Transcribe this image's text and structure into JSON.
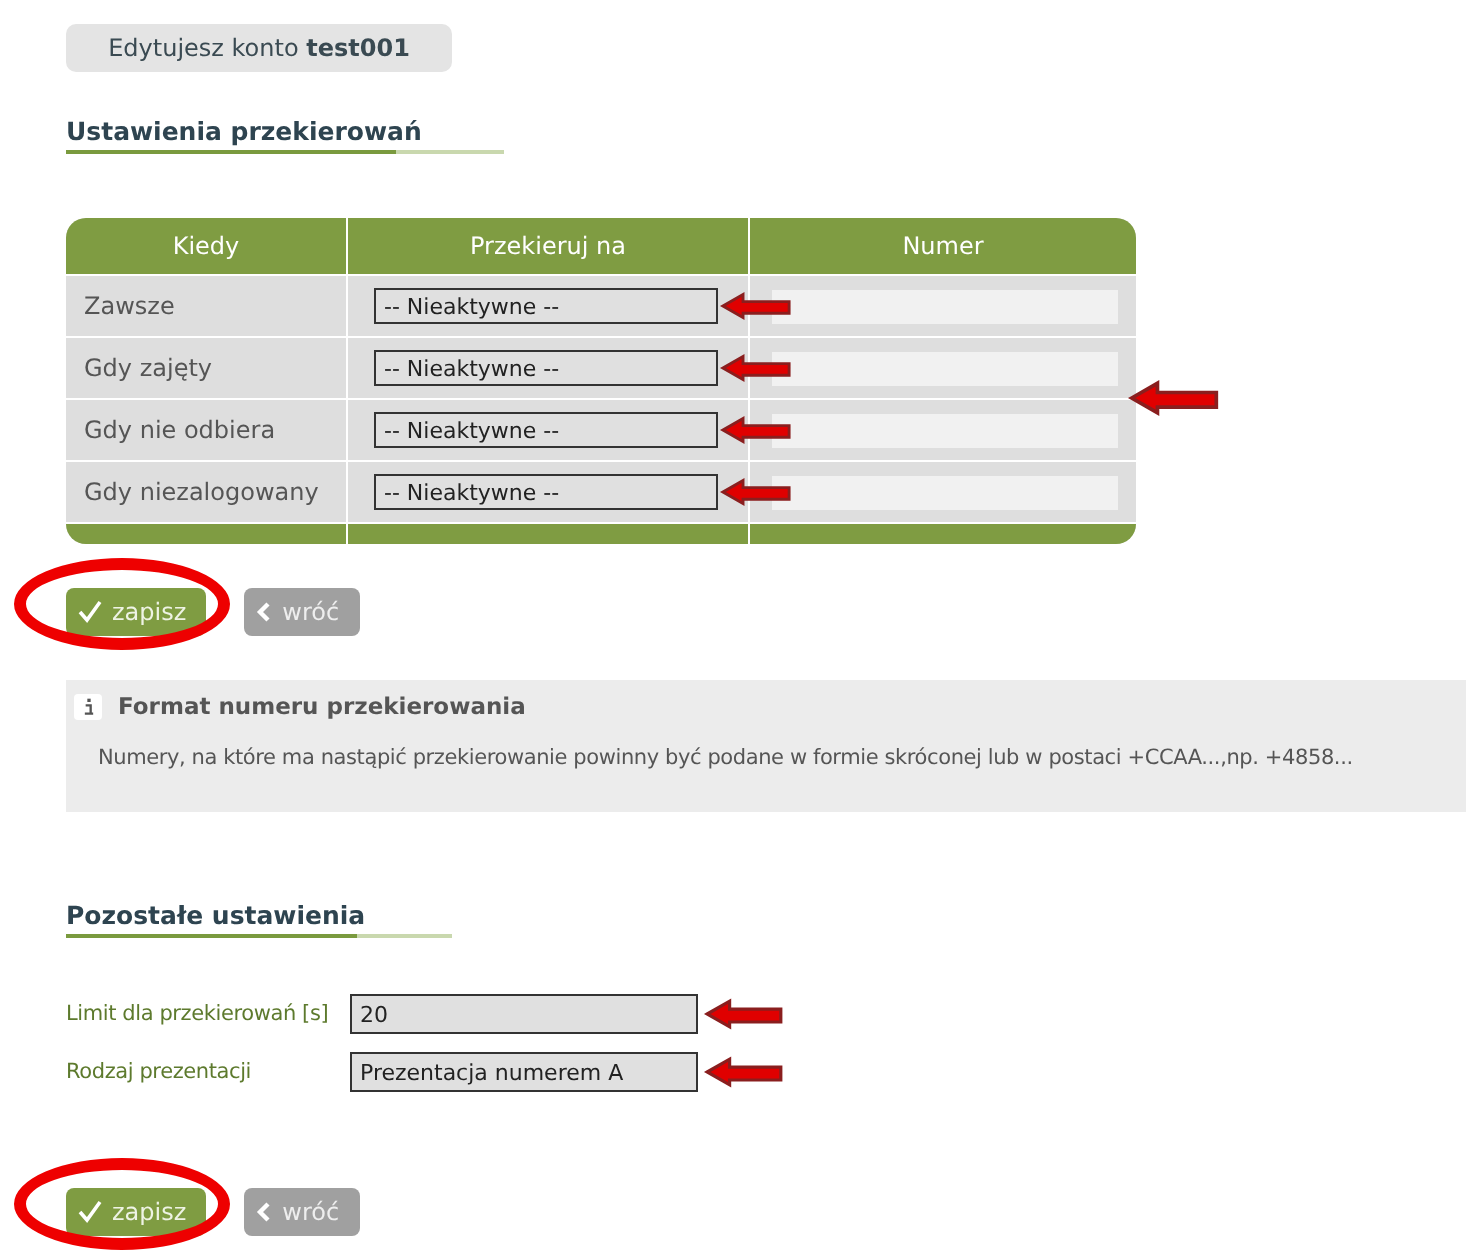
{
  "account_badge": {
    "text": "Edytujesz konto **test001**"
  },
  "redirect_section": {
    "title": "Ustawienia przekierowań",
    "table": {
      "columns": [
        "Kiedy",
        "Przekieruj na",
        "Numer"
      ],
      "number_column_marked": true,
      "rows": [
        {
          "when": "Zawsze",
          "target": "-- Nieaktywne --",
          "marked": true
        },
        {
          "when": "Gdy zajęty",
          "target": "-- Nieaktywne --",
          "marked": true
        },
        {
          "when": "Gdy nie odbiera",
          "target": "-- Nieaktywne --",
          "marked": true
        },
        {
          "when": "Gdy niezalogowany",
          "target": "-- Nieaktywne --",
          "marked": true
        }
      ]
    },
    "buttons": [
      {
        "kind": "save",
        "label": "zapisz",
        "circled": true
      },
      {
        "kind": "back",
        "label": "wróć",
        "circled": false
      }
    ]
  },
  "info": {
    "title": "Format numeru przekierowania",
    "text": "Numery, na które ma nastąpić przekierowanie powinny być podane w formie skróconej lub w postaci +CCAA...,np. +4858..."
  },
  "other_section": {
    "title": "Pozostałe ustawienia",
    "fields": [
      {
        "label": "Limit dla przekierowań [s]",
        "value": "20",
        "marked": true
      },
      {
        "label": "Rodzaj prezentacji",
        "value": "Prezentacja numerem A",
        "marked": true
      }
    ],
    "buttons": [
      {
        "kind": "save",
        "label": "zapisz",
        "circled": true
      },
      {
        "kind": "back",
        "label": "wróć",
        "circled": false
      }
    ]
  }
}
